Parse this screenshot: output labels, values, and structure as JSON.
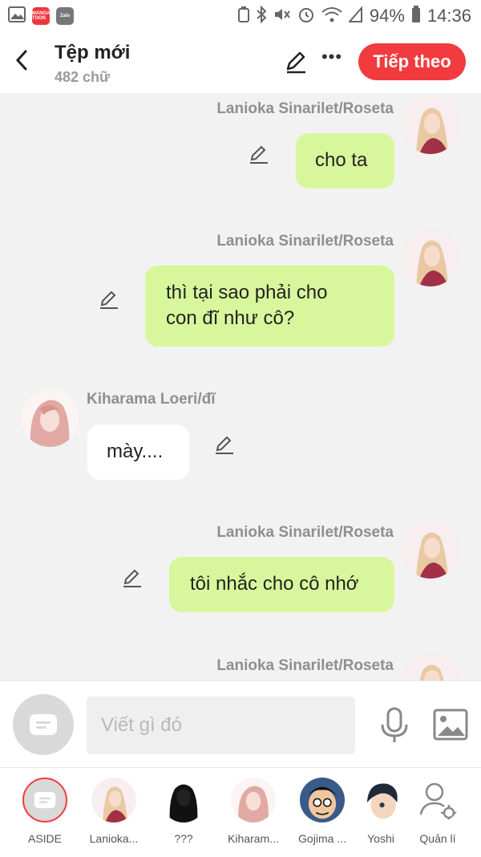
{
  "status_bar": {
    "apps": [
      "MANGA TOON",
      "Zalo"
    ],
    "battery": "94%",
    "time": "14:36"
  },
  "header": {
    "title": "Tệp mới",
    "subtitle": "482 chữ",
    "next_label": "Tiếp theo"
  },
  "messages": [
    {
      "side": "right",
      "name": "Lanioka Sinarilet/Roseta",
      "lines": [
        "cho ta"
      ]
    },
    {
      "side": "right",
      "name": "Lanioka Sinarilet/Roseta",
      "lines": [
        "thì tại sao phải cho",
        "con đĩ như cô?"
      ]
    },
    {
      "side": "left",
      "name": "Kiharama Loeri/đĩ",
      "lines": [
        "mày...."
      ]
    },
    {
      "side": "right",
      "name": "Lanioka Sinarilet/Roseta",
      "lines": [
        "tôi nhắc cho cô nhớ"
      ]
    },
    {
      "side": "right",
      "name": "Lanioka Sinarilet/Roseta",
      "lines": []
    }
  ],
  "composer": {
    "placeholder": "Viết gì đó"
  },
  "characters": [
    {
      "label": "ASIDE"
    },
    {
      "label": "Lanioka..."
    },
    {
      "label": "???"
    },
    {
      "label": "Kiharam..."
    },
    {
      "label": "Gojima ..."
    },
    {
      "label": "Yoshi"
    },
    {
      "label": "Quản lí"
    }
  ],
  "colors": {
    "accent": "#f23b3f",
    "bubble_self": "#d8f79d",
    "bubble_other": "#ffffff",
    "background": "#f2f2f2"
  }
}
